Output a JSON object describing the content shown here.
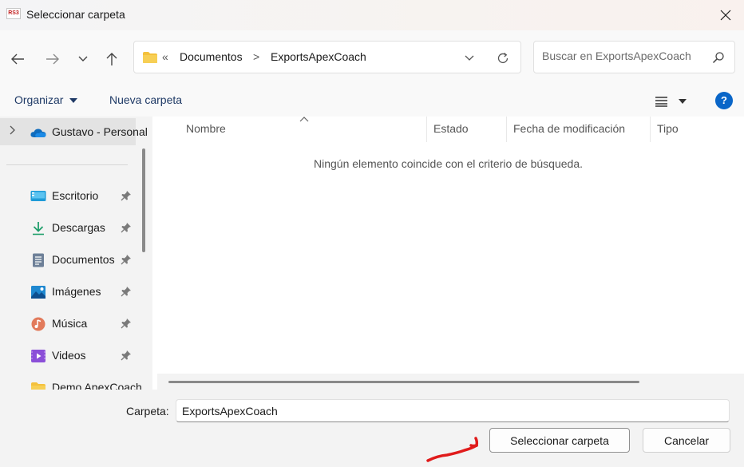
{
  "window": {
    "title": "Seleccionar carpeta",
    "app_icon_text": "RS3"
  },
  "navigation": {
    "back_icon": "arrow-left-icon",
    "forward_icon": "arrow-right-icon",
    "recent_icon": "chevron-down-icon",
    "up_icon": "arrow-up-icon"
  },
  "address": {
    "overflow": "«",
    "crumbs": [
      "Documentos",
      "ExportsApexCoach"
    ],
    "separator": ">"
  },
  "search": {
    "placeholder": "Buscar en ExportsApexCoach"
  },
  "commands": {
    "organize": "Organizar",
    "new_folder": "Nueva carpeta",
    "help": "?"
  },
  "sidebar": {
    "onedrive": "Gustavo - Personal",
    "items": [
      {
        "label": "Escritorio",
        "icon": "desktop-icon",
        "pinned": true
      },
      {
        "label": "Descargas",
        "icon": "download-icon",
        "pinned": true
      },
      {
        "label": "Documentos",
        "icon": "documents-icon",
        "pinned": true
      },
      {
        "label": "Imágenes",
        "icon": "pictures-icon",
        "pinned": true
      },
      {
        "label": "Música",
        "icon": "music-icon",
        "pinned": true
      },
      {
        "label": "Videos",
        "icon": "videos-icon",
        "pinned": true
      },
      {
        "label": "Demo ApexCoach",
        "icon": "folder-icon",
        "pinned": false
      }
    ]
  },
  "content": {
    "columns": [
      "Nombre",
      "Estado",
      "Fecha de modificación",
      "Tipo"
    ],
    "empty_message": "Ningún elemento coincide con el criterio de búsqueda."
  },
  "footer": {
    "folder_label": "Carpeta:",
    "folder_value": "ExportsApexCoach",
    "select_button": "Seleccionar carpeta",
    "cancel_button": "Cancelar"
  },
  "colors": {
    "accent": "#0a66c8",
    "folder": "#f4c13d",
    "annotation": "#e01b1b"
  }
}
